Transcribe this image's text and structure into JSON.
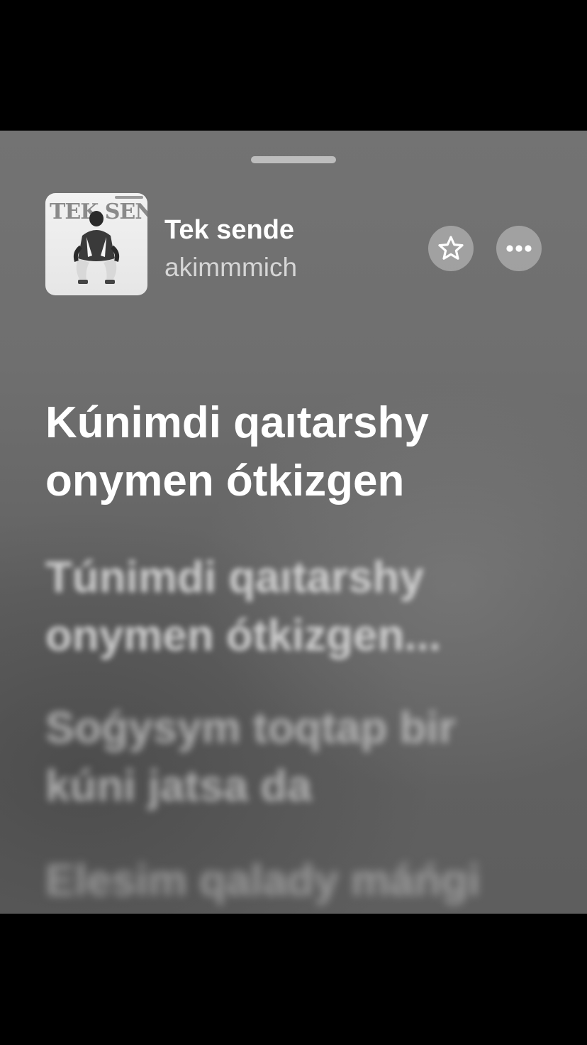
{
  "now_playing": {
    "title": "Tek sende",
    "artist": "akimmmich",
    "artwork": {
      "text": "TEK SENDE",
      "description_icon": "album-cover"
    }
  },
  "controls": {
    "favorite_icon": "star-outline-icon",
    "more_icon": "ellipsis-icon"
  },
  "lyrics": {
    "current": [
      "Kúnimdi qaıtarshy",
      "onymen ótkizgen"
    ],
    "upcoming": [
      [
        "Túnimdi qaıtarshy",
        "onymen ótkizgen..."
      ],
      [
        "Soǵysym toqtap bir",
        "kúni jatsa da"
      ],
      [
        "Elesim qalady máńgi"
      ]
    ]
  },
  "colors": {
    "background": "#6b6b6b",
    "text_primary": "#ffffff",
    "text_secondary": "#d6d6d6",
    "button_fill": "#b8b8b8"
  }
}
